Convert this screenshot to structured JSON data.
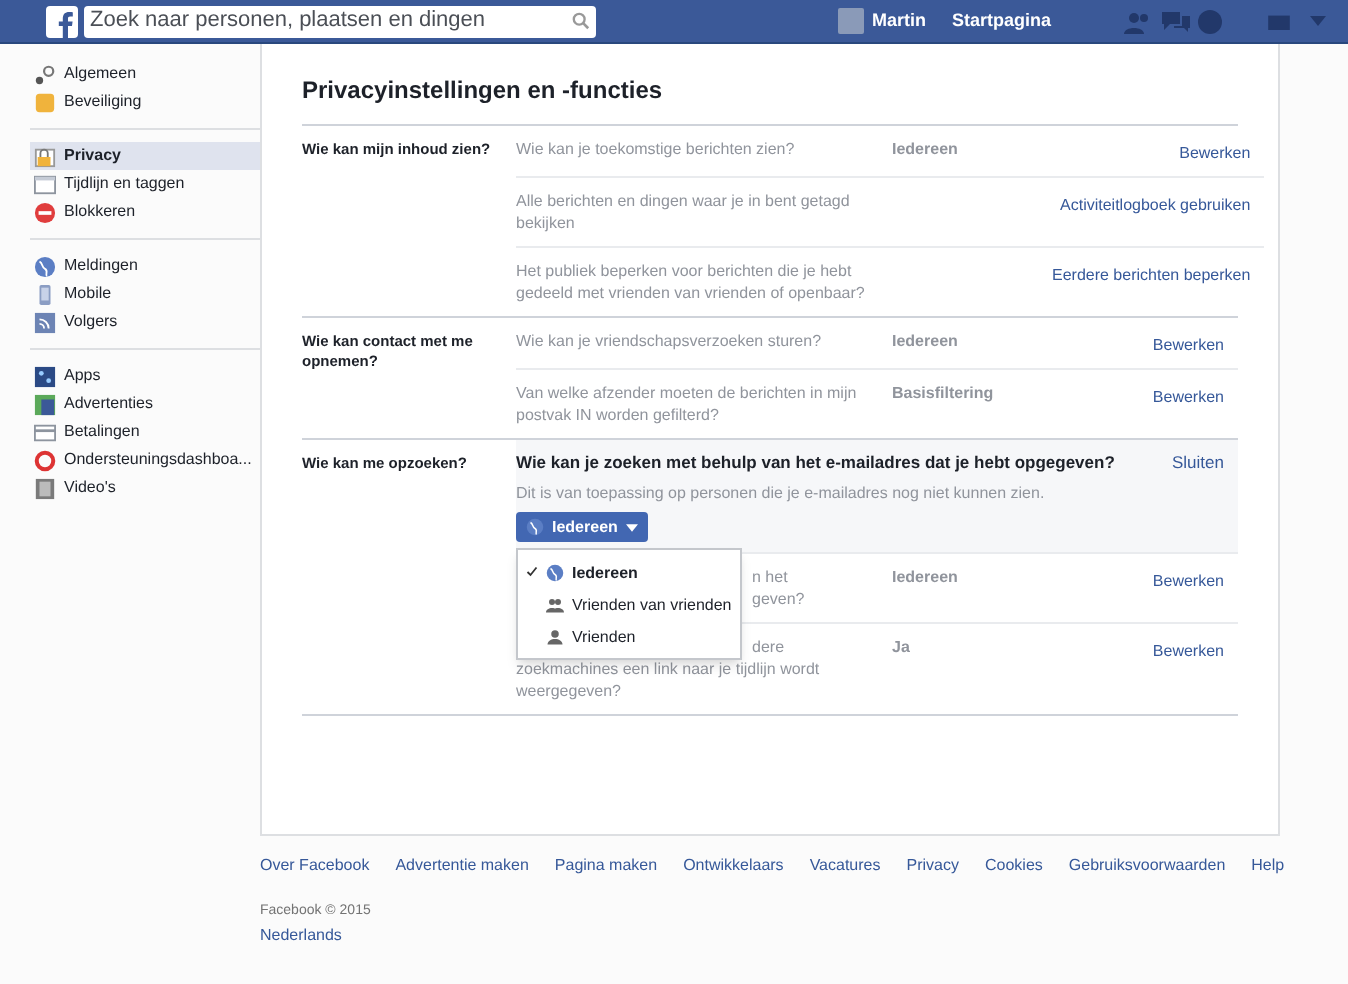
{
  "topbar": {
    "search": {
      "placeholder": "Zoek naar personen, plaatsen en dingen"
    },
    "user": "Martin",
    "home": "Startpagina"
  },
  "sidebar": {
    "groups": [
      [
        {
          "label": "Algemeen",
          "selected": false
        },
        {
          "label": "Beveiliging",
          "selected": false
        }
      ],
      [
        {
          "label": "Privacy",
          "selected": true
        },
        {
          "label": "Tijdlijn en taggen",
          "selected": false
        },
        {
          "label": "Blokkeren",
          "selected": false
        }
      ],
      [
        {
          "label": "Meldingen",
          "selected": false
        },
        {
          "label": "Mobile",
          "selected": false
        },
        {
          "label": "Volgers",
          "selected": false
        }
      ],
      [
        {
          "label": "Apps",
          "selected": false
        },
        {
          "label": "Advertenties",
          "selected": false
        },
        {
          "label": "Betalingen",
          "selected": false
        },
        {
          "label": "Ondersteuningsdashboa...",
          "selected": false
        },
        {
          "label": "Video's",
          "selected": false
        }
      ]
    ]
  },
  "main": {
    "title": "Privacyinstellingen en -functies",
    "sections": [
      {
        "label": "Wie kan mijn inhoud zien?",
        "rows": [
          {
            "kind": "row",
            "description": [
              "Wie kan je toekomstige berichten zien?"
            ],
            "value": "Iedereen",
            "action": "Bewerken"
          },
          {
            "kind": "row",
            "description": [
              "Alle berichten en dingen waar je in bent getagd bekijken"
            ],
            "action": "Activiteitlogboek gebruiken"
          },
          {
            "kind": "row",
            "description": [
              "Het publiek beperken voor berichten die je hebt gedeeld met vrienden van vrienden of openbaar?"
            ],
            "action": "Eerdere berichten beperken"
          }
        ]
      },
      {
        "label": "Wie kan contact met me opnemen?",
        "rows": [
          {
            "kind": "row",
            "description": [
              "Wie kan je vriendschapsverzoeken sturen?"
            ],
            "value": "Iedereen",
            "action": "Bewerken"
          },
          {
            "kind": "row",
            "description": [
              "Van welke afzender moeten de berichten in mijn postvak IN worden gefilterd?"
            ],
            "value": "Basisfiltering",
            "action": "Bewerken"
          }
        ]
      },
      {
        "label": "Wie kan me opzoeken?",
        "rows": [
          {
            "kind": "expanded",
            "question": "Wie kan je zoeken met behulp van het e-mailadres dat je hebt opgegeven?",
            "note": "Dit is van toepassing op personen die je e-mailadres nog niet kunnen zien.",
            "action": "Sluiten",
            "button": "Iedereen",
            "menu": [
              {
                "label": "Iedereen",
                "selected": true
              },
              {
                "label": "Vrienden van vrienden",
                "selected": false
              },
              {
                "label": "Vrienden",
                "selected": false
              }
            ]
          },
          {
            "kind": "row",
            "covered_lines": [
              "n het",
              "geven?"
            ],
            "value": "Iedereen",
            "action": "Bewerken"
          },
          {
            "kind": "row",
            "covered_lines": [
              "dere"
            ],
            "description": [
              "zoekmachines een link naar je tijdlijn wordt weergegeven?"
            ],
            "value": "Ja",
            "action": "Bewerken"
          }
        ]
      }
    ]
  },
  "footer": {
    "links": [
      "Over Facebook",
      "Advertentie maken",
      "Pagina maken",
      "Ontwikkelaars",
      "Vacatures",
      "Privacy",
      "Cookies",
      "Gebruiksvoorwaarden",
      "Help"
    ],
    "copyright": "Facebook © 2015",
    "language": "Nederlands"
  }
}
